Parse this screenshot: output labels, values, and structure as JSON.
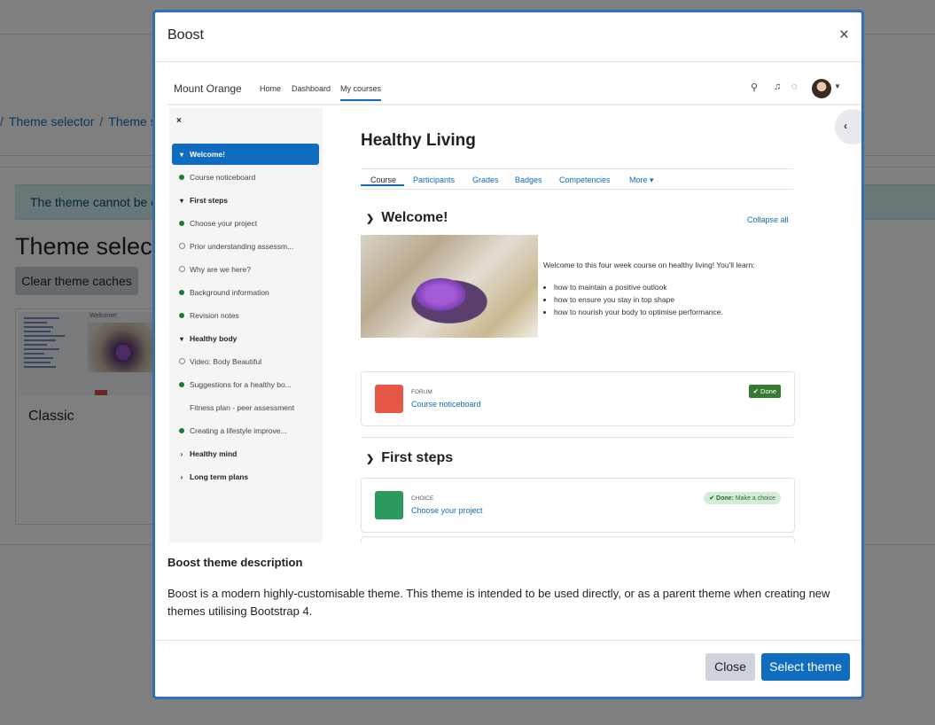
{
  "background": {
    "breadcrumb": [
      "Theme selector",
      "Theme se"
    ],
    "alert": "The theme cannot be ch",
    "page_title": "Theme select",
    "clear_button": "Clear theme caches",
    "card_label": "Classic",
    "card_thumb_header": "Welcome!"
  },
  "modal": {
    "title": "Boost",
    "close_icon": "×",
    "description_title": "Boost theme description",
    "description": "Boost is a modern highly-customisable theme. This theme is intended to be used directly, or as a parent theme when creating new themes utilising Bootstrap 4.",
    "buttons": {
      "close": "Close",
      "select": "Select theme"
    }
  },
  "preview": {
    "brand": "Mount Orange",
    "nav": [
      "Home",
      "Dashboard",
      "My courses"
    ],
    "sidebar_close": "×",
    "sidebar": [
      {
        "label": "Welcome!",
        "kind": "section-active"
      },
      {
        "label": "Course noticeboard",
        "kind": "done"
      },
      {
        "label": "First steps",
        "kind": "section"
      },
      {
        "label": "Choose your project",
        "kind": "done"
      },
      {
        "label": "Prior understanding assessm...",
        "kind": "todo"
      },
      {
        "label": "Why are we here?",
        "kind": "todo"
      },
      {
        "label": "Background information",
        "kind": "done"
      },
      {
        "label": "Revision notes",
        "kind": "done"
      },
      {
        "label": "Healthy body",
        "kind": "section"
      },
      {
        "label": "Video: Body Beautiful",
        "kind": "todo"
      },
      {
        "label": "Suggestions for a healthy bo...",
        "kind": "done"
      },
      {
        "label": "Fitness plan - peer assessment",
        "kind": "none"
      },
      {
        "label": "Creating a lifestyle improve...",
        "kind": "done"
      },
      {
        "label": "Healthy mind",
        "kind": "section-closed"
      },
      {
        "label": "Long term plans",
        "kind": "section-closed"
      }
    ],
    "course_title": "Healthy Living",
    "tabs": [
      "Course",
      "Participants",
      "Grades",
      "Badges",
      "Competencies",
      "More ▾"
    ],
    "section1": "Welcome!",
    "collapse_all": "Collapse all",
    "welcome_text": "Welcome to this four week course on healthy living! You'll learn:",
    "bullets": [
      "how to maintain a positive outlook",
      "how to ensure you stay in top shape",
      "how to nourish your body to optimise performance."
    ],
    "forum": {
      "type": "FORUM",
      "name": "Course noticeboard",
      "status": "✔ Done"
    },
    "section2": "First steps",
    "choice": {
      "type": "CHOICE",
      "name": "Choose your project",
      "status_bold": "✔ Done:",
      "status_rest": " Make a choice"
    },
    "colors": {
      "accent": "#0f6cbf",
      "done": "#357a32",
      "forum_icon": "#e65845",
      "choice_icon": "#2b9a5c"
    }
  }
}
